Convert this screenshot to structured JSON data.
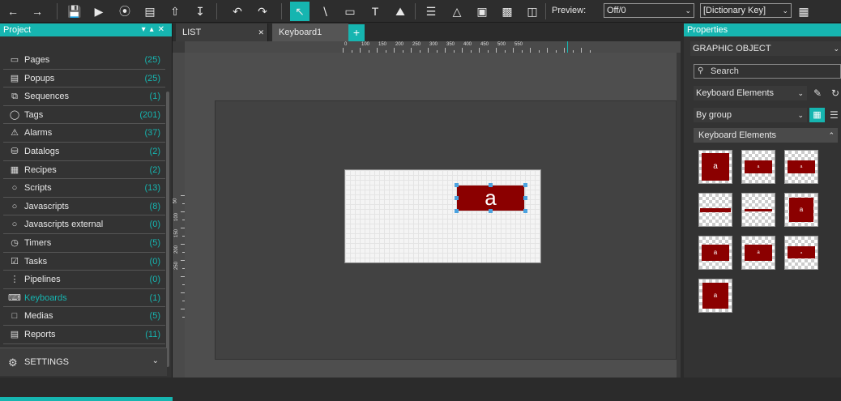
{
  "toolbar": {
    "preview_label": "Preview:",
    "preview_value": "Off/0",
    "dictionary_value": "[Dictionary Key]"
  },
  "project": {
    "title": "Project",
    "items": [
      {
        "label": "Pages",
        "count": "(25)"
      },
      {
        "label": "Popups",
        "count": "(25)"
      },
      {
        "label": "Sequences",
        "count": "(1)"
      },
      {
        "label": "Tags",
        "count": "(201)"
      },
      {
        "label": "Alarms",
        "count": "(37)"
      },
      {
        "label": "Datalogs",
        "count": "(2)"
      },
      {
        "label": "Recipes",
        "count": "(2)"
      },
      {
        "label": "Scripts",
        "count": "(13)"
      },
      {
        "label": "Javascripts",
        "count": "(8)"
      },
      {
        "label": "Javascripts external",
        "count": "(0)"
      },
      {
        "label": "Timers",
        "count": "(5)"
      },
      {
        "label": "Tasks",
        "count": "(0)"
      },
      {
        "label": "Pipelines",
        "count": "(0)"
      },
      {
        "label": "Keyboards",
        "count": "(1)"
      },
      {
        "label": "Medias",
        "count": "(5)"
      },
      {
        "label": "Reports",
        "count": "(11)"
      }
    ],
    "settings_label": "SETTINGS"
  },
  "tabs": {
    "list": "LIST",
    "keyboard1": "Keyboard1",
    "add": "+"
  },
  "canvas": {
    "key_char": "a",
    "ruler_top": [
      "0",
      "100",
      "150",
      "200",
      "250",
      "300",
      "350",
      "400",
      "450",
      "500",
      "550"
    ],
    "ruler_left": [
      "50",
      "100",
      "150",
      "200",
      "250"
    ]
  },
  "properties": {
    "title": "Properties",
    "section": "GRAPHIC OBJECT",
    "search_placeholder": "Search",
    "category": "Keyboard Elements",
    "grouping": "By group",
    "group_header": "Keyboard Elements",
    "thumb_char": "a"
  },
  "colors": {
    "accent": "#16b5b0",
    "key_red": "#8b0000"
  }
}
